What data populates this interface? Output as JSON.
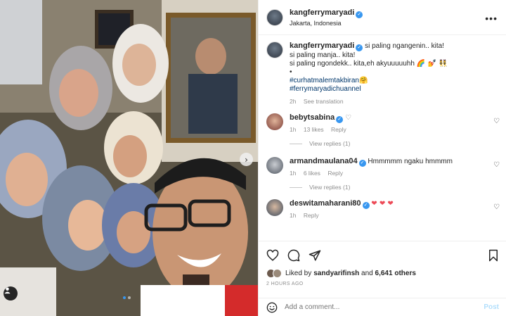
{
  "header": {
    "username": "kangferrymaryadi",
    "location": "Jakarta, Indonesia",
    "more_icon": "ellipsis-icon"
  },
  "caption": {
    "username": "kangferrymaryadi",
    "line1": " si paling ngangenin.. kita!",
    "line2": "si paling manja.. kita!",
    "line3": "si paling ngondekk.. kita,eh akyuuuuuhh",
    "line3_emoji": "🌈 💅 👯",
    "bullet": "•",
    "hashtag1": "#curhatmalemtakbiran",
    "hashtag1_emoji": "🤗",
    "hashtag2": "#ferrymaryadichuannel",
    "time": "2h",
    "see_translation": "See translation"
  },
  "comments": [
    {
      "username": "bebytsabina",
      "verified": true,
      "text": "",
      "text_emoji": "♡",
      "time": "1h",
      "likes": "13 likes",
      "reply": "Reply",
      "view_replies": "View replies (1)",
      "avatar_color": "#c98a6a"
    },
    {
      "username": "armandmaulana04",
      "verified": true,
      "text": "Hmmmmm ngaku hmmmm",
      "time": "1h",
      "likes": "6 likes",
      "reply": "Reply",
      "view_replies": "View replies (1)",
      "avatar_color": "#7a7f86"
    },
    {
      "username": "deswitamaharani80",
      "verified": true,
      "text": "",
      "text_emoji": "❤ ❤ ❤",
      "time": "1h",
      "likes": "",
      "reply": "Reply",
      "avatar_color": "#5a6b7e"
    }
  ],
  "actions": {
    "like_icon": "heart-icon",
    "comment_icon": "comment-icon",
    "share_icon": "share-icon",
    "save_icon": "bookmark-icon"
  },
  "likes": {
    "prefix": "Liked by ",
    "user": "sandyarifinsh",
    "middle": " and ",
    "count": "6,641 others"
  },
  "time_ago": "2 HOURS AGO",
  "add_comment": {
    "placeholder": "Add a comment...",
    "post_label": "Post",
    "emoji_icon": "smiley-icon"
  },
  "carousel": {
    "current": 1,
    "total": 2
  },
  "colors": {
    "accent": "#3897f0",
    "link": "#00376b",
    "muted": "#8e8e8e",
    "post_disabled": "#b2dffc",
    "heart_red": "#ed4956"
  }
}
